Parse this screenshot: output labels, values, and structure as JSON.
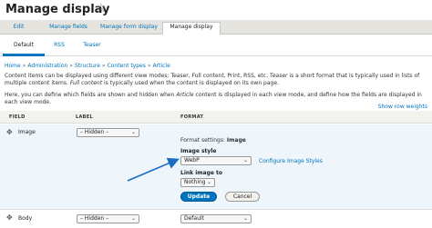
{
  "page": {
    "title": "Manage display",
    "favorite_icon": "star-outline-icon"
  },
  "primary_tabs": [
    {
      "label": "Edit",
      "active": false
    },
    {
      "label": "Manage fields",
      "active": false
    },
    {
      "label": "Manage form display",
      "active": false
    },
    {
      "label": "Manage display",
      "active": true
    }
  ],
  "secondary_tabs": [
    {
      "label": "Default",
      "active": true
    },
    {
      "label": "RSS",
      "active": false
    },
    {
      "label": "Teaser",
      "active": false
    }
  ],
  "breadcrumb": [
    "Home",
    "Administration",
    "Structure",
    "Content types",
    "Article"
  ],
  "breadcrumb_separator": "»",
  "description": {
    "line1_a": "Content items can be displayed using different view modes: Teaser, Full content, Print, RSS, etc.",
    "line1_teaser": "Teaser",
    "line1_b": "is a short format that is typically used in lists of multiple content",
    "line2_a": "items.",
    "line2_full": "Full content",
    "line2_b": "is typically used when the content is displayed on its own page.",
    "line3_a": "Here, you can define which fields are shown and hidden when",
    "line3_article": "Article",
    "line3_b": "content is displayed in each view mode, and define how the fields are displayed in each view mode."
  },
  "show_row_weights": "Show row weights",
  "table": {
    "headers": {
      "field": "FIELD",
      "label": "LABEL",
      "format": "FORMAT"
    },
    "rows": [
      {
        "field": "Image",
        "label_value": "– Hidden –",
        "format_settings_prefix": "Format settings:",
        "format_settings_name": "Image",
        "image_style_label": "Image style",
        "image_style_value": "WebP",
        "configure_link": "Configure Image Styles",
        "link_image_to_label": "Link image to",
        "link_image_to_value": "Nothing",
        "update_button": "Update",
        "cancel_button": "Cancel"
      },
      {
        "field": "Body",
        "label_value": "– Hidden –",
        "format_value": "Default"
      }
    ]
  },
  "colors": {
    "link": "#0074bd",
    "arrow": "#1a6fc4",
    "highlight_row": "#eef5fb"
  }
}
